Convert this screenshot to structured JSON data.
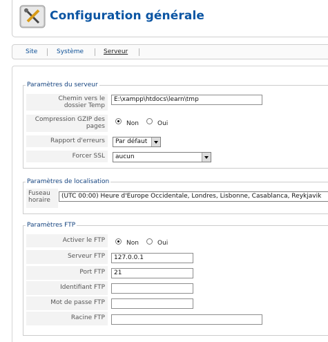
{
  "header": {
    "title": "Configuration générale",
    "icon": "tools-icon"
  },
  "tabs": [
    {
      "label": "Site"
    },
    {
      "label": "Système"
    },
    {
      "label": "Serveur"
    }
  ],
  "server": {
    "legend": "Paramètres du serveur",
    "temp_path": {
      "label_line1": "Chemin vers le",
      "label_line2": "dossier Temp",
      "value": "E:\\xampp\\htdocs\\learn\\tmp"
    },
    "gzip": {
      "label_line1": "Compression GZIP des",
      "label_line2": "pages",
      "option_no": "Non",
      "option_yes": "Oui",
      "selected": "Non"
    },
    "errors": {
      "label": "Rapport d'erreurs",
      "value": "Par défaut"
    },
    "ssl": {
      "label": "Forcer SSL",
      "value": "aucun"
    }
  },
  "locale": {
    "legend": "Paramètres de localisation",
    "timezone": {
      "label_line1": "Fuseau",
      "label_line2": "horaire",
      "value": "(UTC 00:00) Heure d'Europe Occidentale, Londres, Lisbonne, Casablanca, Reykjavik"
    }
  },
  "ftp": {
    "legend": "Paramètres FTP",
    "enable": {
      "label": "Activer le FTP",
      "option_no": "Non",
      "option_yes": "Oui",
      "selected": "Non"
    },
    "host": {
      "label": "Serveur FTP",
      "value": "127.0.0.1"
    },
    "port": {
      "label": "Port FTP",
      "value": "21"
    },
    "user": {
      "label": "Identifiant FTP",
      "value": ""
    },
    "password": {
      "label": "Mot de passe FTP",
      "value": ""
    },
    "root": {
      "label": "Racine FTP",
      "value": ""
    }
  },
  "colors": {
    "title": "#0b55a3",
    "link": "#0b4f96",
    "legend": "#14437f"
  }
}
